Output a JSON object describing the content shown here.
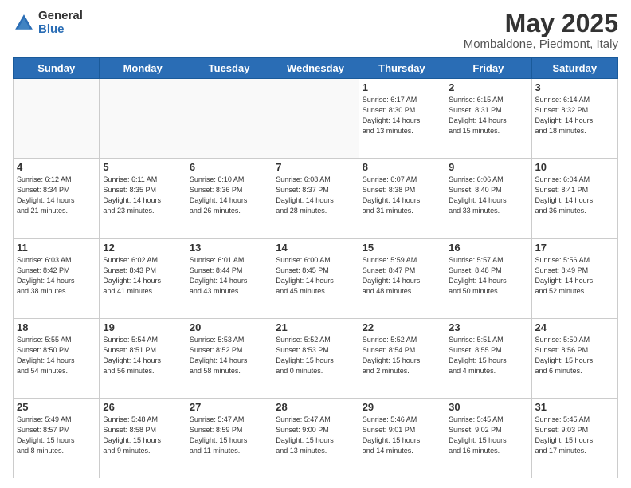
{
  "header": {
    "logo_general": "General",
    "logo_blue": "Blue",
    "month_title": "May 2025",
    "location": "Mombaldone, Piedmont, Italy"
  },
  "days_of_week": [
    "Sunday",
    "Monday",
    "Tuesday",
    "Wednesday",
    "Thursday",
    "Friday",
    "Saturday"
  ],
  "weeks": [
    [
      {
        "day": "",
        "info": ""
      },
      {
        "day": "",
        "info": ""
      },
      {
        "day": "",
        "info": ""
      },
      {
        "day": "",
        "info": ""
      },
      {
        "day": "1",
        "info": "Sunrise: 6:17 AM\nSunset: 8:30 PM\nDaylight: 14 hours\nand 13 minutes."
      },
      {
        "day": "2",
        "info": "Sunrise: 6:15 AM\nSunset: 8:31 PM\nDaylight: 14 hours\nand 15 minutes."
      },
      {
        "day": "3",
        "info": "Sunrise: 6:14 AM\nSunset: 8:32 PM\nDaylight: 14 hours\nand 18 minutes."
      }
    ],
    [
      {
        "day": "4",
        "info": "Sunrise: 6:12 AM\nSunset: 8:34 PM\nDaylight: 14 hours\nand 21 minutes."
      },
      {
        "day": "5",
        "info": "Sunrise: 6:11 AM\nSunset: 8:35 PM\nDaylight: 14 hours\nand 23 minutes."
      },
      {
        "day": "6",
        "info": "Sunrise: 6:10 AM\nSunset: 8:36 PM\nDaylight: 14 hours\nand 26 minutes."
      },
      {
        "day": "7",
        "info": "Sunrise: 6:08 AM\nSunset: 8:37 PM\nDaylight: 14 hours\nand 28 minutes."
      },
      {
        "day": "8",
        "info": "Sunrise: 6:07 AM\nSunset: 8:38 PM\nDaylight: 14 hours\nand 31 minutes."
      },
      {
        "day": "9",
        "info": "Sunrise: 6:06 AM\nSunset: 8:40 PM\nDaylight: 14 hours\nand 33 minutes."
      },
      {
        "day": "10",
        "info": "Sunrise: 6:04 AM\nSunset: 8:41 PM\nDaylight: 14 hours\nand 36 minutes."
      }
    ],
    [
      {
        "day": "11",
        "info": "Sunrise: 6:03 AM\nSunset: 8:42 PM\nDaylight: 14 hours\nand 38 minutes."
      },
      {
        "day": "12",
        "info": "Sunrise: 6:02 AM\nSunset: 8:43 PM\nDaylight: 14 hours\nand 41 minutes."
      },
      {
        "day": "13",
        "info": "Sunrise: 6:01 AM\nSunset: 8:44 PM\nDaylight: 14 hours\nand 43 minutes."
      },
      {
        "day": "14",
        "info": "Sunrise: 6:00 AM\nSunset: 8:45 PM\nDaylight: 14 hours\nand 45 minutes."
      },
      {
        "day": "15",
        "info": "Sunrise: 5:59 AM\nSunset: 8:47 PM\nDaylight: 14 hours\nand 48 minutes."
      },
      {
        "day": "16",
        "info": "Sunrise: 5:57 AM\nSunset: 8:48 PM\nDaylight: 14 hours\nand 50 minutes."
      },
      {
        "day": "17",
        "info": "Sunrise: 5:56 AM\nSunset: 8:49 PM\nDaylight: 14 hours\nand 52 minutes."
      }
    ],
    [
      {
        "day": "18",
        "info": "Sunrise: 5:55 AM\nSunset: 8:50 PM\nDaylight: 14 hours\nand 54 minutes."
      },
      {
        "day": "19",
        "info": "Sunrise: 5:54 AM\nSunset: 8:51 PM\nDaylight: 14 hours\nand 56 minutes."
      },
      {
        "day": "20",
        "info": "Sunrise: 5:53 AM\nSunset: 8:52 PM\nDaylight: 14 hours\nand 58 minutes."
      },
      {
        "day": "21",
        "info": "Sunrise: 5:52 AM\nSunset: 8:53 PM\nDaylight: 15 hours\nand 0 minutes."
      },
      {
        "day": "22",
        "info": "Sunrise: 5:52 AM\nSunset: 8:54 PM\nDaylight: 15 hours\nand 2 minutes."
      },
      {
        "day": "23",
        "info": "Sunrise: 5:51 AM\nSunset: 8:55 PM\nDaylight: 15 hours\nand 4 minutes."
      },
      {
        "day": "24",
        "info": "Sunrise: 5:50 AM\nSunset: 8:56 PM\nDaylight: 15 hours\nand 6 minutes."
      }
    ],
    [
      {
        "day": "25",
        "info": "Sunrise: 5:49 AM\nSunset: 8:57 PM\nDaylight: 15 hours\nand 8 minutes."
      },
      {
        "day": "26",
        "info": "Sunrise: 5:48 AM\nSunset: 8:58 PM\nDaylight: 15 hours\nand 9 minutes."
      },
      {
        "day": "27",
        "info": "Sunrise: 5:47 AM\nSunset: 8:59 PM\nDaylight: 15 hours\nand 11 minutes."
      },
      {
        "day": "28",
        "info": "Sunrise: 5:47 AM\nSunset: 9:00 PM\nDaylight: 15 hours\nand 13 minutes."
      },
      {
        "day": "29",
        "info": "Sunrise: 5:46 AM\nSunset: 9:01 PM\nDaylight: 15 hours\nand 14 minutes."
      },
      {
        "day": "30",
        "info": "Sunrise: 5:45 AM\nSunset: 9:02 PM\nDaylight: 15 hours\nand 16 minutes."
      },
      {
        "day": "31",
        "info": "Sunrise: 5:45 AM\nSunset: 9:03 PM\nDaylight: 15 hours\nand 17 minutes."
      }
    ]
  ]
}
